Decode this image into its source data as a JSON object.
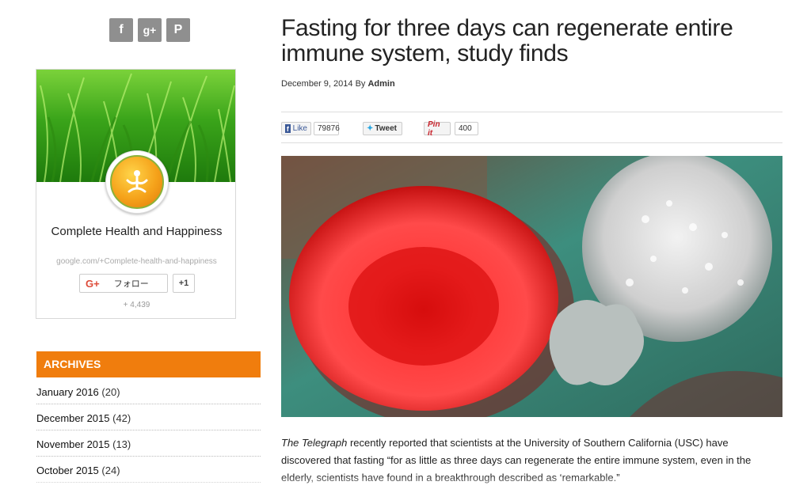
{
  "social": {
    "facebook": {
      "icon": "facebook-icon",
      "glyph": "f"
    },
    "googleplus": {
      "icon": "google-plus-icon",
      "glyph": "g+"
    },
    "pinterest": {
      "icon": "pinterest-icon",
      "glyph": "P"
    }
  },
  "gplus_badge": {
    "page_name": "Complete Health and Happiness",
    "page_url": "google.com/+Complete-health-and-happiness",
    "follow_label": "フォロー",
    "plus_one": "+1",
    "follower_count": "+ 4,439"
  },
  "archives": {
    "heading": "ARCHIVES",
    "items": [
      {
        "month": "January 2016",
        "count": "(20)"
      },
      {
        "month": "December 2015",
        "count": "(42)"
      },
      {
        "month": "November 2015",
        "count": "(13)"
      },
      {
        "month": "October 2015",
        "count": "(24)"
      }
    ]
  },
  "article": {
    "title": "Fasting for three days can regenerate entire immune system, study finds",
    "date": "December 9, 2014",
    "by": "By",
    "author": "Admin",
    "share": {
      "fb_like": "Like",
      "fb_count": "79876",
      "tweet": "Tweet",
      "pin": "Pin it",
      "pin_count": "400"
    },
    "body_source": "The Telegraph",
    "body_text": " recently reported that scientists at the University of Southern California (USC) have discovered that fasting “for as little as three days can regenerate the entire immune system, even in the elderly, scientists have found in a breakthrough described as ‘remarkable.”"
  },
  "colors": {
    "accent": "#f07d0d",
    "social_icon_bg": "#8f8f8f"
  }
}
